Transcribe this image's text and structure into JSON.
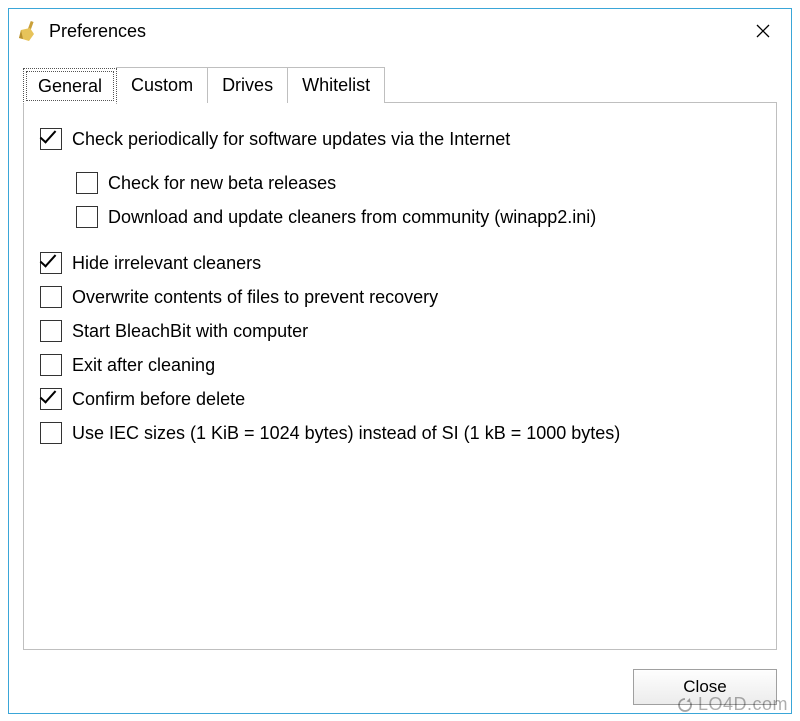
{
  "window": {
    "title": "Preferences"
  },
  "tabs": {
    "items": [
      {
        "label": "General",
        "active": true
      },
      {
        "label": "Custom",
        "active": false
      },
      {
        "label": "Drives",
        "active": false
      },
      {
        "label": "Whitelist",
        "active": false
      }
    ]
  },
  "options": {
    "check_updates": {
      "label": "Check periodically for software updates via the Internet",
      "checked": true
    },
    "beta": {
      "label": "Check for new beta releases",
      "checked": false
    },
    "winapp2": {
      "label": "Download and update cleaners from community (winapp2.ini)",
      "checked": false
    },
    "hide_irrelevant": {
      "label": "Hide irrelevant cleaners",
      "checked": true
    },
    "overwrite": {
      "label": "Overwrite contents of files to prevent recovery",
      "checked": false
    },
    "start_with": {
      "label": "Start BleachBit with computer",
      "checked": false
    },
    "exit_after": {
      "label": "Exit after cleaning",
      "checked": false
    },
    "confirm_delete": {
      "label": "Confirm before delete",
      "checked": true
    },
    "iec_sizes": {
      "label": "Use IEC sizes (1 KiB = 1024 bytes) instead of SI (1 kB = 1000 bytes)",
      "checked": false
    }
  },
  "buttons": {
    "close": "Close"
  },
  "watermark": "LO4D.com"
}
